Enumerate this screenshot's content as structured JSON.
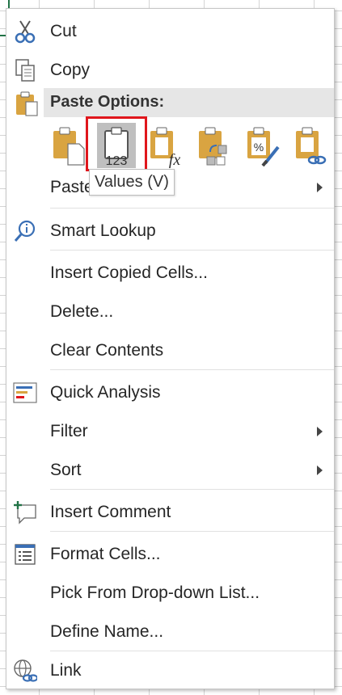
{
  "menu": {
    "cut": "Cut",
    "copy": "Copy",
    "paste_options_header": "Paste Options:",
    "paste_special": "Paste",
    "smart_lookup": "Smart Lookup",
    "insert_copied_cells": "Insert Copied Cells...",
    "delete": "Delete...",
    "clear_contents": "Clear Contents",
    "quick_analysis": "Quick Analysis",
    "filter": "Filter",
    "sort": "Sort",
    "insert_comment": "Insert Comment",
    "format_cells": "Format Cells...",
    "pick_from_list": "Pick From Drop-down List...",
    "define_name": "Define Name...",
    "link": "Link"
  },
  "paste_icons": {
    "values_badge": "123",
    "formula_badge": "fx",
    "percent_badge": "%"
  },
  "tooltip": "Values (V)",
  "colors": {
    "clipboard": "#d9a441",
    "selection_outline": "#e0161c",
    "header_bg": "#e6e6e6",
    "grid_accent": "#217346"
  },
  "icons": [
    "scissors-icon",
    "copy-icon",
    "paste-icon",
    "smart-lookup-icon",
    "quick-analysis-icon",
    "comment-icon",
    "format-cells-icon",
    "link-icon"
  ]
}
